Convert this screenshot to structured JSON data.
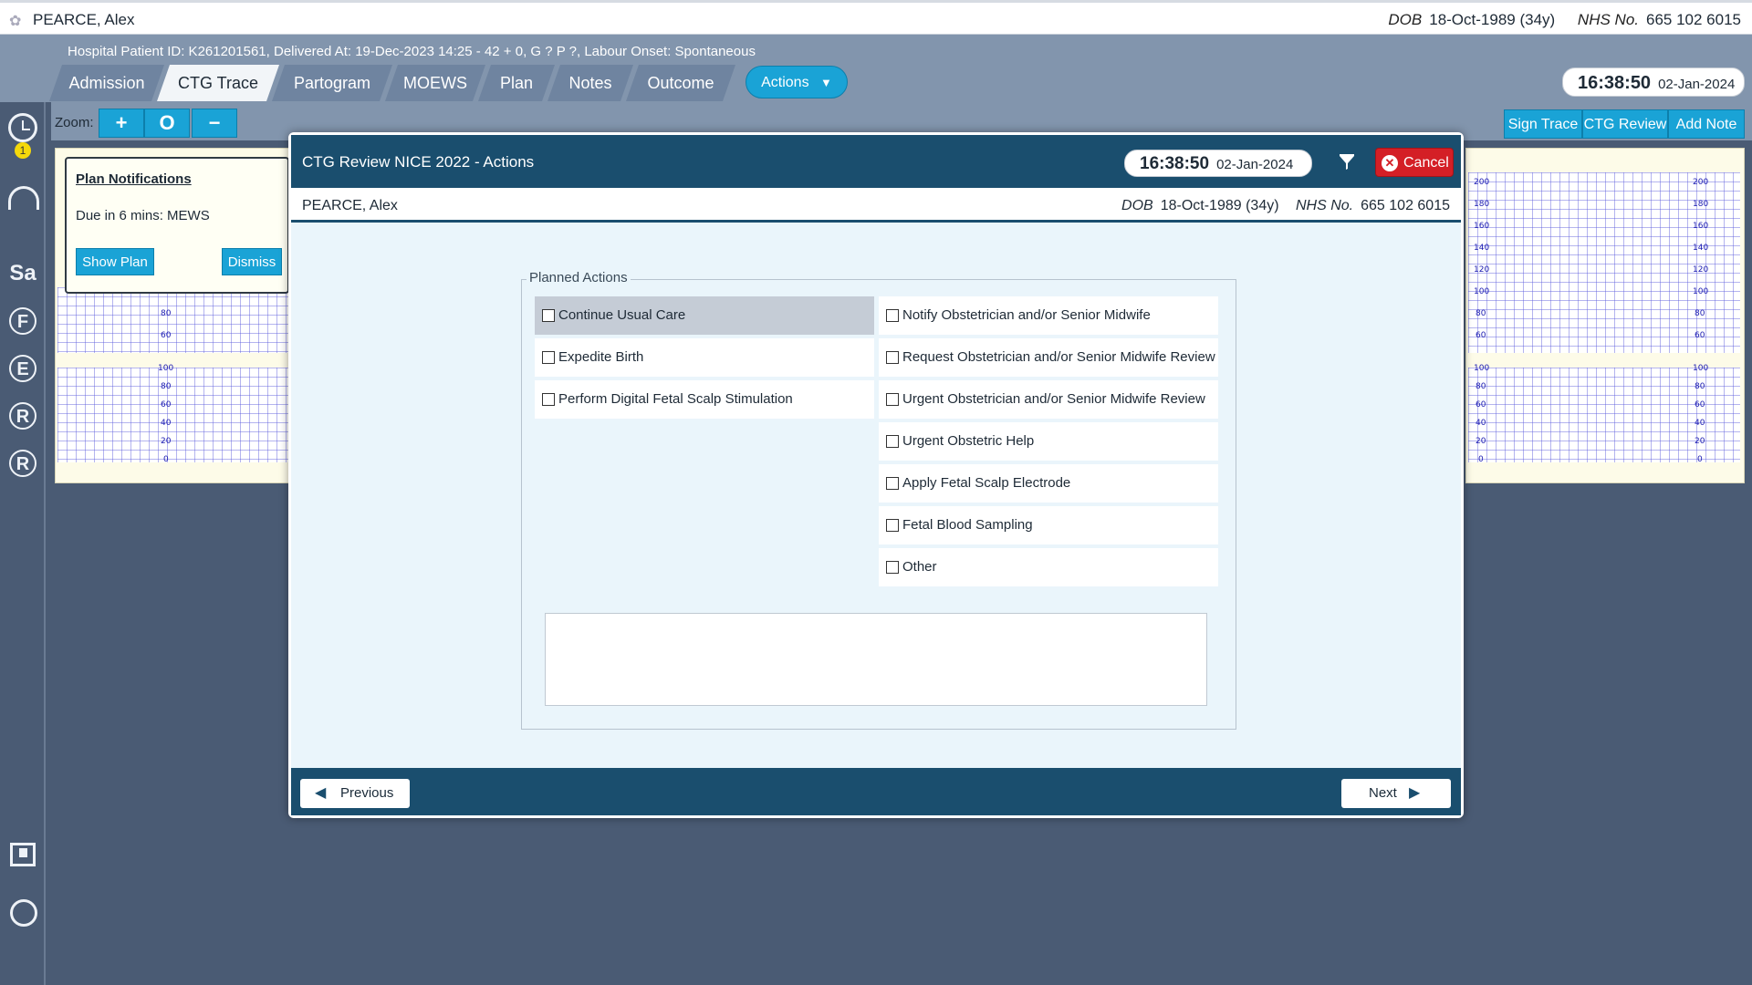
{
  "topbar": {
    "patient_name": "PEARCE, Alex",
    "dob_label": "DOB",
    "dob_value": "18-Oct-1989 (34y)",
    "nhs_label": "NHS No.",
    "nhs_value": "665 102 6015"
  },
  "header": {
    "patient_line": "Hospital Patient ID: K261201561, Delivered At: 19-Dec-2023 14:25 - 42 + 0, G ? P ?,   Labour Onset: Spontaneous",
    "tabs": [
      {
        "label": "Admission"
      },
      {
        "label": "CTG Trace"
      },
      {
        "label": "Partogram"
      },
      {
        "label": "MOEWS"
      },
      {
        "label": "Plan"
      },
      {
        "label": "Notes"
      },
      {
        "label": "Outcome"
      }
    ],
    "actions_label": "Actions",
    "clock_time": "16:38:50",
    "clock_date": "02-Jan-2024"
  },
  "toolbar": {
    "zoom_label": "Zoom:",
    "zoom_in": "+",
    "zoom_reset": "O",
    "zoom_out": "−",
    "sign_trace": "Sign Trace",
    "ctg_review": "CTG Review",
    "add_note": "Add Note"
  },
  "leftbar": {
    "alarm_badge": "1",
    "letters": [
      "Sa",
      "F",
      "E",
      "R",
      "R"
    ]
  },
  "chart": {
    "fhr_ticks": [
      "200",
      "180",
      "160",
      "140",
      "120",
      "100",
      "80",
      "60"
    ],
    "toco_ticks": [
      "100",
      "80",
      "60",
      "40",
      "20",
      "0"
    ],
    "left_fhr_ticks": [
      "80",
      "60"
    ]
  },
  "plan_notification": {
    "title": "Plan Notifications",
    "message": "Due in 6 mins: MEWS",
    "show_plan": "Show Plan",
    "dismiss": "Dismiss"
  },
  "modal": {
    "title": "CTG Review NICE 2022 - Actions",
    "clock_time": "16:38:50",
    "clock_date": "02-Jan-2024",
    "cancel_label": "Cancel",
    "patient_name": "PEARCE, Alex",
    "dob_label": "DOB",
    "dob_value": "18-Oct-1989 (34y)",
    "nhs_label": "NHS No.",
    "nhs_value": "665 102 6015",
    "legend": "Planned Actions",
    "left_actions": [
      {
        "label": "Continue Usual Care",
        "checked": false
      },
      {
        "label": "Expedite Birth",
        "checked": false
      },
      {
        "label": "Perform Digital Fetal Scalp Stimulation",
        "checked": false
      }
    ],
    "right_actions": [
      {
        "label": "Notify Obstetrician and/or Senior Midwife",
        "checked": false
      },
      {
        "label": "Request Obstetrician and/or Senior Midwife Review",
        "checked": false
      },
      {
        "label": "Urgent Obstetrician and/or Senior Midwife Review",
        "checked": false
      },
      {
        "label": "Urgent Obstetric Help",
        "checked": false
      },
      {
        "label": "Apply Fetal Scalp Electrode",
        "checked": false
      },
      {
        "label": "Fetal Blood Sampling",
        "checked": false
      },
      {
        "label": "Other",
        "checked": false
      }
    ],
    "notes_value": "",
    "previous_label": "Previous",
    "next_label": "Next"
  }
}
